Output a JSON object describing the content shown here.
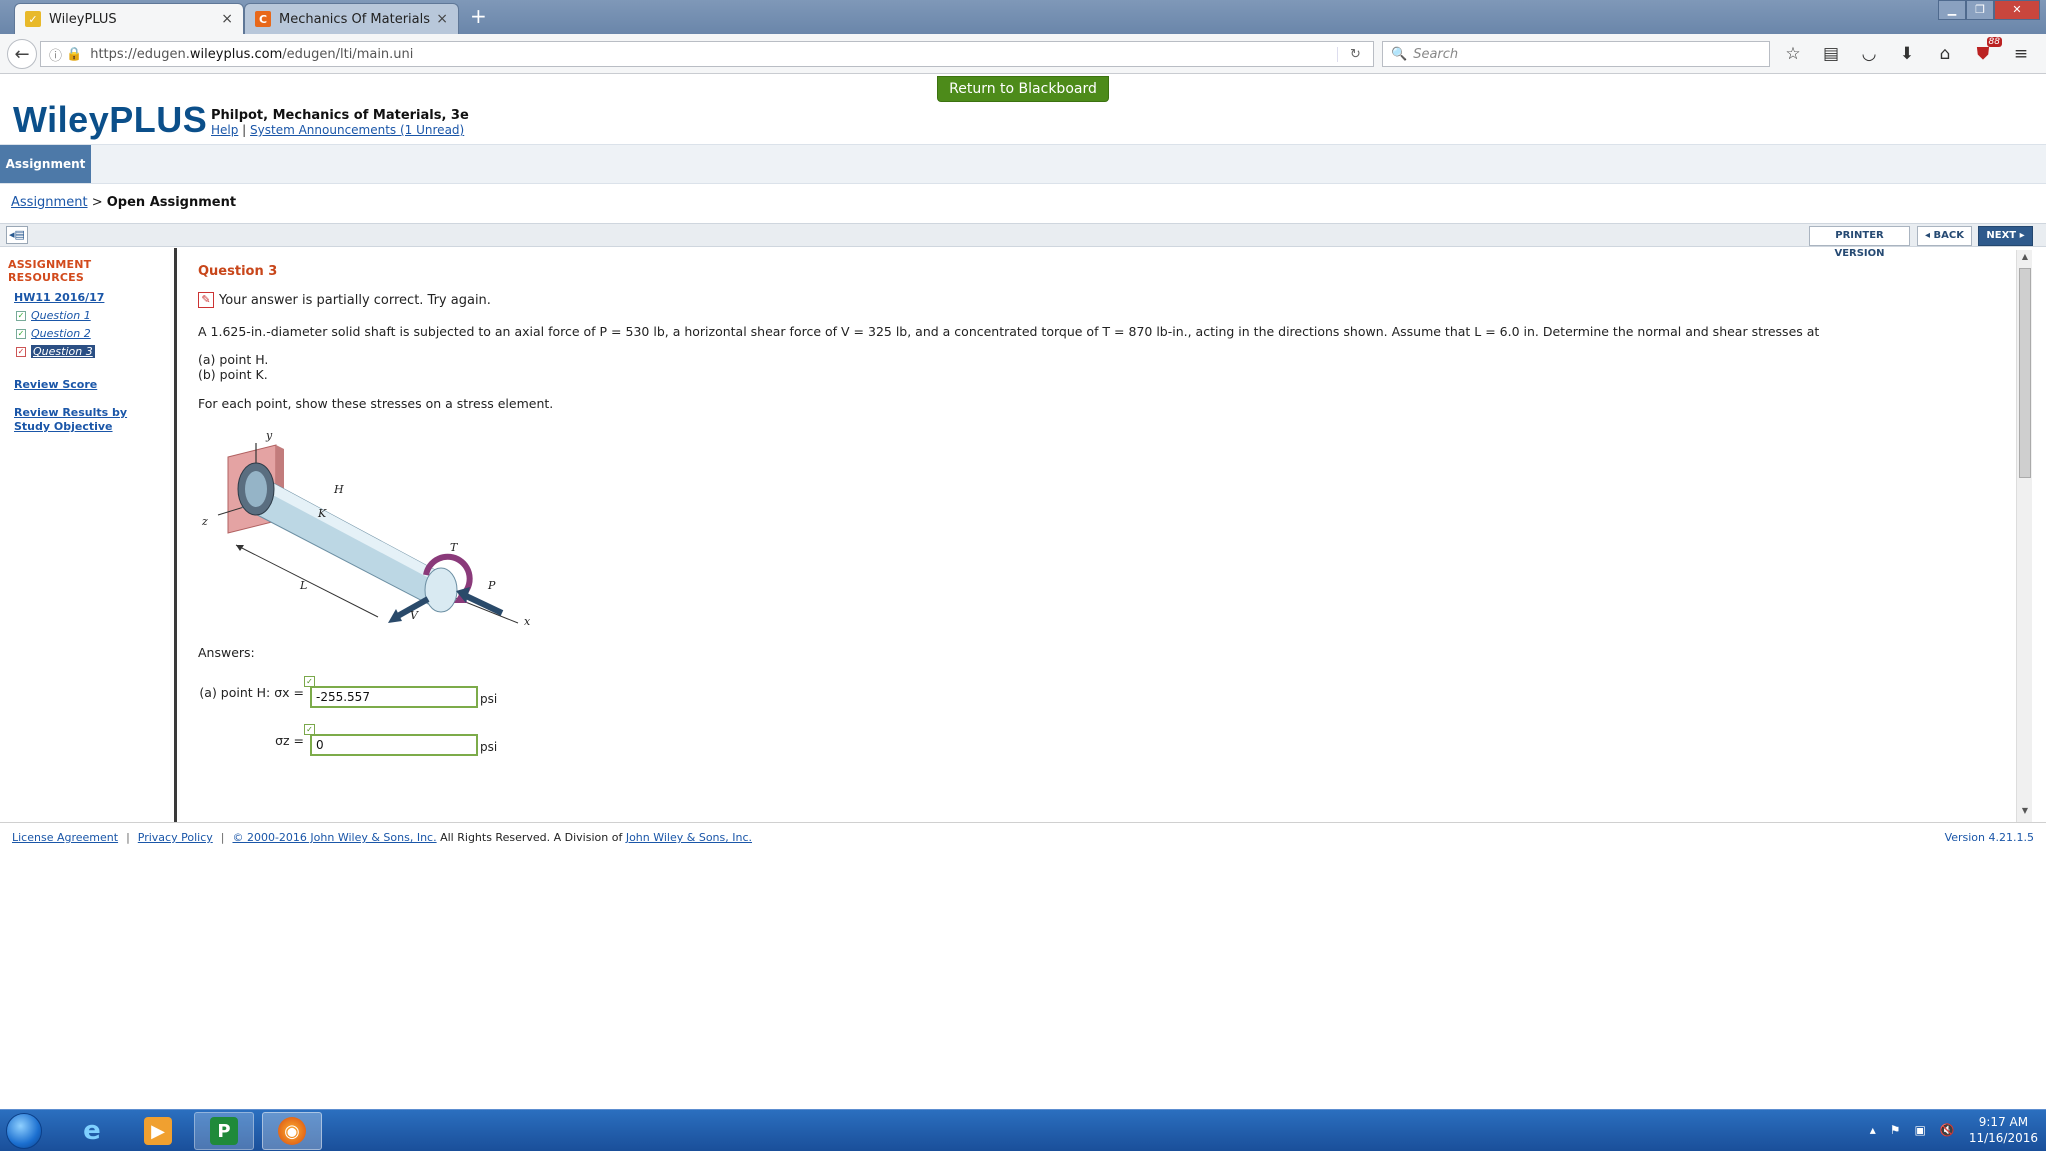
{
  "browser": {
    "tabs": [
      {
        "label": "WileyPLUS",
        "active": true
      },
      {
        "label": "Mechanics Of Materials 3r...",
        "active": false
      }
    ],
    "url_prefix": "https://edugen.",
    "url_domain": "wileyplus.com",
    "url_path": "/edugen/lti/main.uni",
    "search_placeholder": "Search",
    "addon_badge": "88"
  },
  "page": {
    "return_button": "Return to Blackboard",
    "logo": "WileyPLUS",
    "book_title": "Philpot, Mechanics of Materials, 3e",
    "help_link": "Help",
    "announcements_link": "System Announcements (1 Unread)",
    "tab_assignment": "Assignment",
    "breadcrumb_link": "Assignment",
    "breadcrumb_sep": ">",
    "breadcrumb_current": "Open Assignment",
    "printer_version": "PRINTER VERSION",
    "back": "◂ BACK",
    "next": "NEXT ▸"
  },
  "sidebar": {
    "title": "ASSIGNMENT RESOURCES",
    "hw_link": "HW11 2016/17",
    "questions": [
      "Question 1",
      "Question 2",
      "Question 3"
    ],
    "review_score": "Review Score",
    "review_results": "Review Results by Study Objective"
  },
  "question": {
    "title": "Question 3",
    "feedback": "Your answer is partially correct.  Try again.",
    "problem": "A 1.625-in.-diameter solid shaft is subjected to an axial force of P = 530 lb, a horizontal shear force of V = 325 lb, and a concentrated torque of T = 870 lb-in., acting in the directions shown. Assume that L = 6.0 in. Determine the normal and shear stresses at",
    "part_a": "(a) point H.",
    "part_b": "(b) point K.",
    "instruction": "For each point, show these stresses on a stress element.",
    "figure_labels": {
      "y": "y",
      "z": "z",
      "x": "x",
      "H": "H",
      "K": "K",
      "T": "T",
      "P": "P",
      "L": "L",
      "V": "V"
    },
    "answers_label": "Answers:",
    "answers": [
      {
        "label": "(a) point H:  σx =",
        "value": "-255.557",
        "unit": "psi"
      },
      {
        "label": "σz =",
        "value": "0",
        "unit": "psi"
      }
    ]
  },
  "footer": {
    "license": "License Agreement",
    "privacy": "Privacy Policy",
    "copyright": "© 2000-2016 John Wiley & Sons, Inc.",
    "rights": " All Rights Reserved. A Division of ",
    "company": "John Wiley & Sons, Inc.",
    "version": "Version 4.21.1.5"
  },
  "taskbar": {
    "time": "9:17 AM",
    "date": "11/16/2016"
  }
}
